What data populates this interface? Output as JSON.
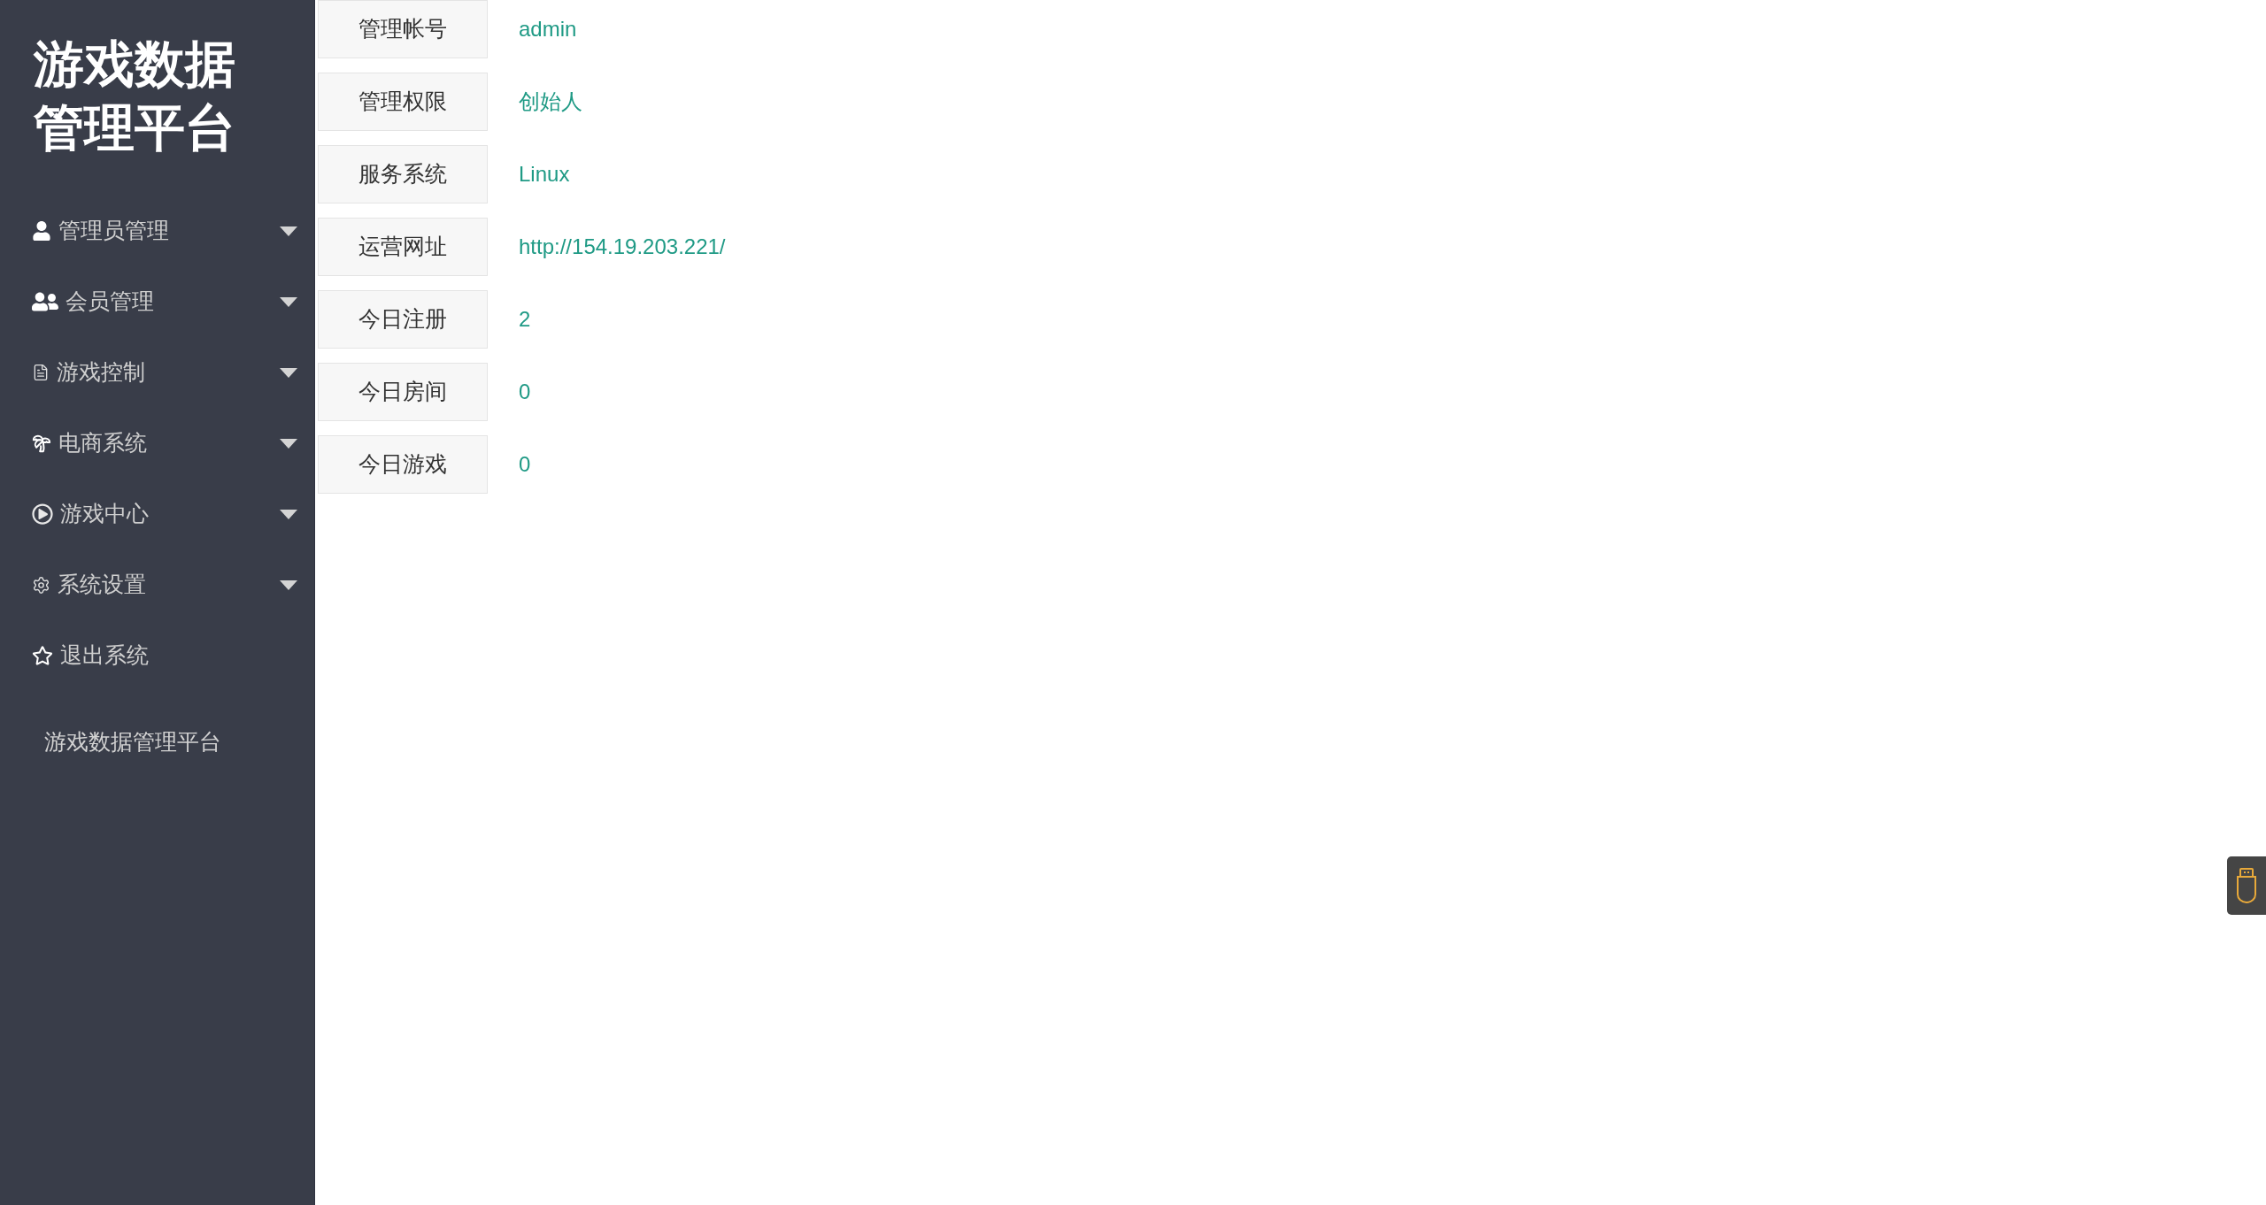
{
  "sidebar": {
    "logo_lines": [
      "游戏数据",
      "管理平台"
    ],
    "menu": [
      {
        "label": "管理员管理",
        "kind": "group"
      },
      {
        "label": "会员管理",
        "kind": "group"
      },
      {
        "label": "游戏控制",
        "kind": "group"
      },
      {
        "label": "电商系统",
        "kind": "group"
      },
      {
        "label": "游戏中心",
        "kind": "group"
      },
      {
        "label": "系统设置",
        "kind": "group"
      },
      {
        "label": "退出系统",
        "kind": "link"
      }
    ],
    "footer": "游戏数据管理平台"
  },
  "info_table": {
    "rows": [
      {
        "label": "管理帐号",
        "value": "admin"
      },
      {
        "label": "管理权限",
        "value": "创始人"
      },
      {
        "label": "服务系统",
        "value": "Linux"
      },
      {
        "label": "运营网址",
        "value": "http://154.19.203.221/"
      },
      {
        "label": "今日注册",
        "value": "2"
      },
      {
        "label": "今日房间",
        "value": "0"
      },
      {
        "label": "今日游戏",
        "value": "0"
      }
    ]
  }
}
